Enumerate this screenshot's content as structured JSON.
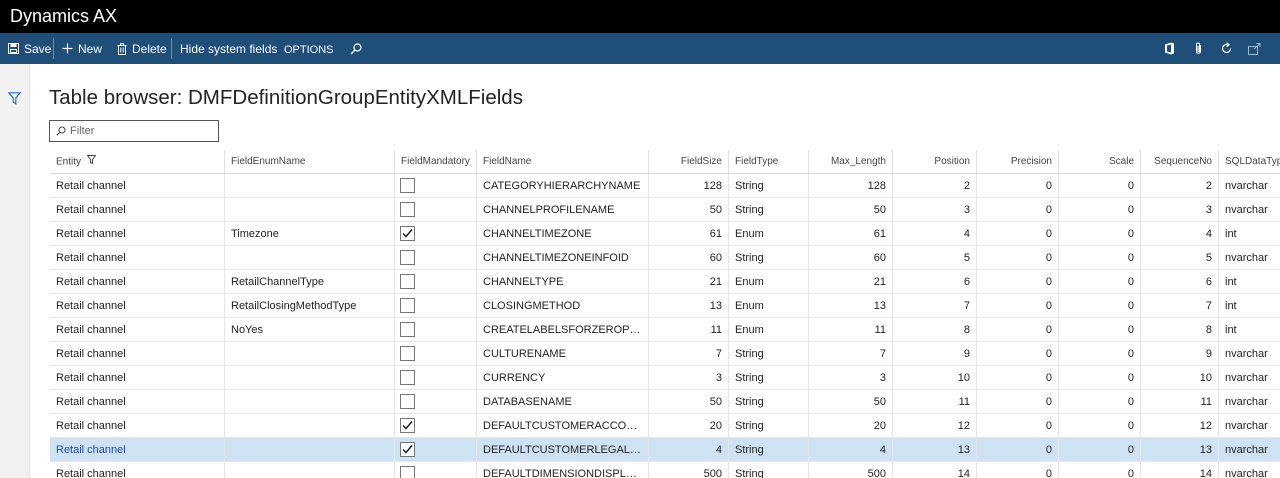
{
  "app": {
    "title": "Dynamics AX"
  },
  "actions": {
    "save": "Save",
    "new": "New",
    "delete": "Delete",
    "hide_system_fields": "Hide system fields",
    "options": "OPTIONS"
  },
  "page": {
    "title": "Table browser: DMFDefinitionGroupEntityXMLFields",
    "filter_placeholder": "Filter"
  },
  "icons": {
    "save": "floppy-disk-icon",
    "new": "plus-icon",
    "delete": "trash-icon",
    "search": "search-icon",
    "office": "office-icon",
    "attach": "paperclip-icon",
    "refresh": "refresh-icon",
    "open": "open-in-new-window-icon",
    "filter_pane": "funnel-icon"
  },
  "colors": {
    "title_bar": "#000000",
    "action_pane": "#1f4e79",
    "selected_row": "#cfe2f3",
    "selected_text": "#1f4e9a"
  },
  "grid": {
    "columns": [
      "Entity",
      "FieldEnumName",
      "FieldMandatory",
      "FieldName",
      "FieldSize",
      "FieldType",
      "Max_Length",
      "Position",
      "Precision",
      "Scale",
      "SequenceNo",
      "SQLDataType"
    ],
    "rows": [
      {
        "entity": "Retail channel",
        "enum": "",
        "mandatory": false,
        "name": "CATEGORYHIERARCHYNAME",
        "size": "128",
        "type": "String",
        "maxlen": "128",
        "pos": "2",
        "prec": "0",
        "scale": "0",
        "seq": "2",
        "sql": "nvarchar"
      },
      {
        "entity": "Retail channel",
        "enum": "",
        "mandatory": false,
        "name": "CHANNELPROFILENAME",
        "size": "50",
        "type": "String",
        "maxlen": "50",
        "pos": "3",
        "prec": "0",
        "scale": "0",
        "seq": "3",
        "sql": "nvarchar"
      },
      {
        "entity": "Retail channel",
        "enum": "Timezone",
        "mandatory": true,
        "name": "CHANNELTIMEZONE",
        "size": "61",
        "type": "Enum",
        "maxlen": "61",
        "pos": "4",
        "prec": "0",
        "scale": "0",
        "seq": "4",
        "sql": "int"
      },
      {
        "entity": "Retail channel",
        "enum": "",
        "mandatory": false,
        "name": "CHANNELTIMEZONEINFOID",
        "size": "60",
        "type": "String",
        "maxlen": "60",
        "pos": "5",
        "prec": "0",
        "scale": "0",
        "seq": "5",
        "sql": "nvarchar"
      },
      {
        "entity": "Retail channel",
        "enum": "RetailChannelType",
        "mandatory": false,
        "name": "CHANNELTYPE",
        "size": "21",
        "type": "Enum",
        "maxlen": "21",
        "pos": "6",
        "prec": "0",
        "scale": "0",
        "seq": "6",
        "sql": "int"
      },
      {
        "entity": "Retail channel",
        "enum": "RetailClosingMethodType",
        "mandatory": false,
        "name": "CLOSINGMETHOD",
        "size": "13",
        "type": "Enum",
        "maxlen": "13",
        "pos": "7",
        "prec": "0",
        "scale": "0",
        "seq": "7",
        "sql": "int"
      },
      {
        "entity": "Retail channel",
        "enum": "NoYes",
        "mandatory": false,
        "name": "CREATELABELSFORZEROPRICE",
        "size": "11",
        "type": "Enum",
        "maxlen": "11",
        "pos": "8",
        "prec": "0",
        "scale": "0",
        "seq": "8",
        "sql": "int"
      },
      {
        "entity": "Retail channel",
        "enum": "",
        "mandatory": false,
        "name": "CULTURENAME",
        "size": "7",
        "type": "String",
        "maxlen": "7",
        "pos": "9",
        "prec": "0",
        "scale": "0",
        "seq": "9",
        "sql": "nvarchar"
      },
      {
        "entity": "Retail channel",
        "enum": "",
        "mandatory": false,
        "name": "CURRENCY",
        "size": "3",
        "type": "String",
        "maxlen": "3",
        "pos": "10",
        "prec": "0",
        "scale": "0",
        "seq": "10",
        "sql": "nvarchar"
      },
      {
        "entity": "Retail channel",
        "enum": "",
        "mandatory": false,
        "name": "DATABASENAME",
        "size": "50",
        "type": "String",
        "maxlen": "50",
        "pos": "11",
        "prec": "0",
        "scale": "0",
        "seq": "11",
        "sql": "nvarchar"
      },
      {
        "entity": "Retail channel",
        "enum": "",
        "mandatory": true,
        "name": "DEFAULTCUSTOMERACCOUNT",
        "size": "20",
        "type": "String",
        "maxlen": "20",
        "pos": "12",
        "prec": "0",
        "scale": "0",
        "seq": "12",
        "sql": "nvarchar"
      },
      {
        "entity": "Retail channel",
        "enum": "",
        "mandatory": true,
        "name": "DEFAULTCUSTOMERLEGALENTI...",
        "size": "4",
        "type": "String",
        "maxlen": "4",
        "pos": "13",
        "prec": "0",
        "scale": "0",
        "seq": "13",
        "sql": "nvarchar",
        "selected": true
      },
      {
        "entity": "Retail channel",
        "enum": "",
        "mandatory": false,
        "name": "DEFAULTDIMENSIONDISPLAYV...",
        "size": "500",
        "type": "String",
        "maxlen": "500",
        "pos": "14",
        "prec": "0",
        "scale": "0",
        "seq": "14",
        "sql": "nvarchar"
      }
    ]
  }
}
